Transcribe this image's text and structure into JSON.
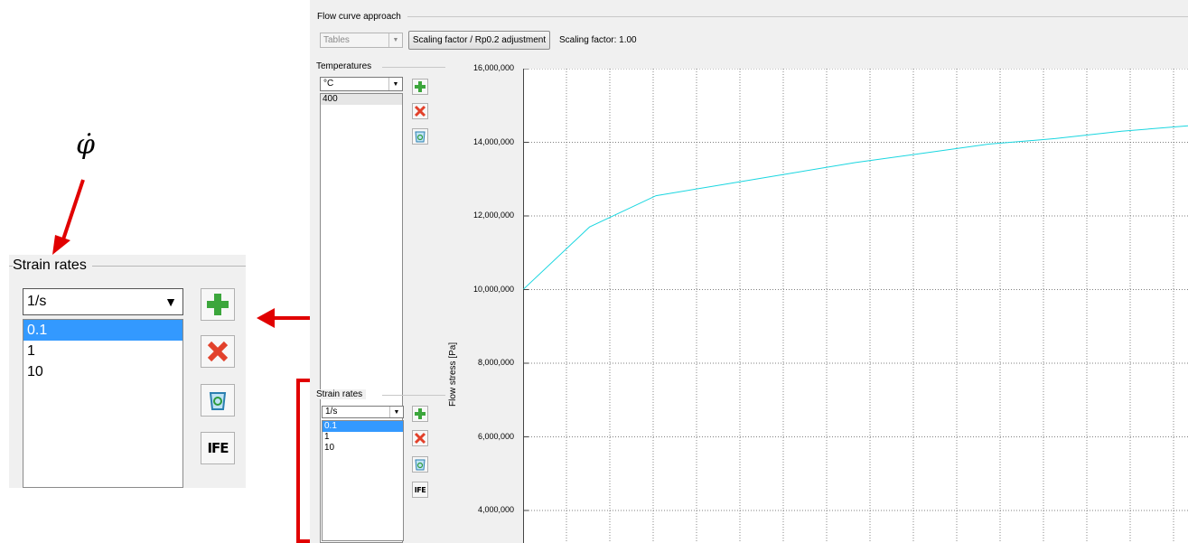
{
  "annotation": {
    "symbol": "φ̇"
  },
  "flow_curve": {
    "group_title": "Flow curve approach",
    "method_select": "Tables",
    "scaling_button": "Scaling factor / Rp0.2 adjustment",
    "scaling_text": "Scaling factor: 1.00"
  },
  "temperatures": {
    "group_title": "Temperatures",
    "unit": "°C",
    "items": [
      "400"
    ]
  },
  "strain_rates": {
    "group_title": "Strain rates",
    "unit": "1/s",
    "items": [
      "0.1",
      "1",
      "10"
    ],
    "selected": "0.1"
  },
  "icons": {
    "add": "plus-icon",
    "delete": "x-icon",
    "clear": "recycle-icon",
    "ife": "ife-logo-icon",
    "ife_text": "IFE"
  },
  "colors": {
    "highlight": "#e10000",
    "curve": "#1ad6e0",
    "selection": "#3399ff"
  },
  "chart_data": {
    "type": "line",
    "ylabel": "Flow stress [Pa]",
    "ytick_labels": [
      "16,000,000",
      "14,000,000",
      "12,000,000",
      "10,000,000",
      "8,000,000",
      "6,000,000",
      "4,000,000"
    ],
    "ylim": [
      3250000,
      16000000
    ],
    "grid": true,
    "series": [
      {
        "x": [
          0,
          0.1,
          0.2,
          0.3,
          0.4,
          0.5,
          0.6,
          0.7,
          0.8,
          0.9,
          1.0
        ],
        "values": [
          10000000,
          11700000,
          12550000,
          12850000,
          13150000,
          13450000,
          13700000,
          13950000,
          14100000,
          14300000,
          14450000
        ]
      }
    ]
  }
}
